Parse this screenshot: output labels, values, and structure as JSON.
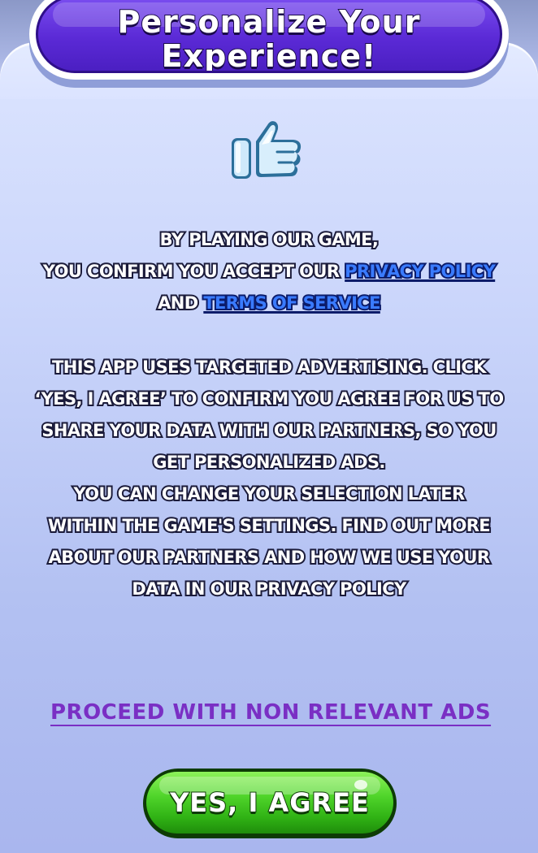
{
  "title": {
    "line1": "Personalize Your",
    "line2": "Experience!"
  },
  "icon": "thumbs-up-icon",
  "consent": {
    "line1": "BY PLAYING OUR GAME,",
    "line2_prefix": "YOU CONFIRM YOU ACCEPT OUR",
    "privacy_policy_link": "PRIVACY POLICY",
    "line3_prefix": "AND",
    "terms_link": "TERMS OF SERVICE"
  },
  "ads_info": {
    "lines": [
      "THIS APP USES TARGETED ADVERTISING. CLICK",
      "‘YES, I AGREE’ TO CONFIRM YOU AGREE FOR US TO",
      "SHARE YOUR DATA WITH OUR PARTNERS, SO YOU",
      "GET PERSONALIZED ADS.",
      "YOU CAN CHANGE YOUR SELECTION LATER",
      "WITHIN THE GAME'S SETTINGS. FIND OUT MORE",
      "ABOUT OUR PARTNERS AND HOW WE USE YOUR",
      "DATA IN OUR PRIVACY POLICY"
    ]
  },
  "actions": {
    "proceed_label": "PROCEED WITH NON RELEVANT ADS",
    "agree_label": "YES, I AGREE"
  },
  "colors": {
    "title_bg": "#5b2ad6",
    "link": "#3a7bff",
    "proceed": "#7a2fc4",
    "agree_button": "#4fd42a"
  }
}
